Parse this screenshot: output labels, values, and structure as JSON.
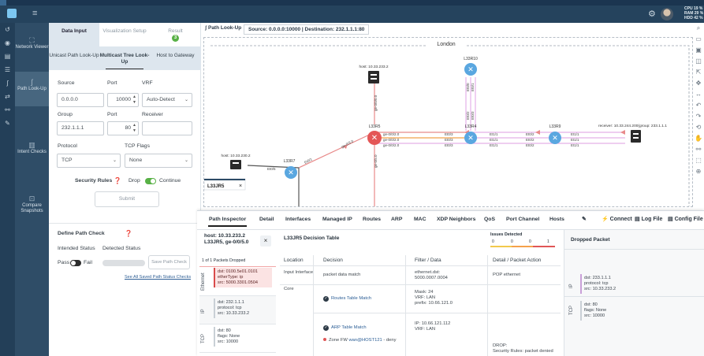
{
  "topbar": {
    "stats_cpu": "CPU 19 %",
    "stats_ram": "RAM 29 %",
    "stats_hdd": "HDD 42 %"
  },
  "nav": {
    "items": [
      {
        "label": "Network Viewer",
        "icon": "network-icon"
      },
      {
        "label": "Path Look-Up",
        "icon": "path-icon"
      },
      {
        "label": "Intent Checks",
        "icon": "intent-icon"
      },
      {
        "label": "Compare Snapshots",
        "icon": "compare-icon"
      }
    ]
  },
  "config": {
    "tabs": {
      "data_input": "Data Input",
      "vis_setup": "Visualization Setup",
      "result": "Result",
      "result_badge": "3"
    },
    "subtabs": {
      "unicast": "Unicast Path Look-Up",
      "multicast": "Multicast Tree Look-Up",
      "host": "Host to Gateway"
    },
    "labels": {
      "source": "Source",
      "port": "Port",
      "vrf": "VRF",
      "group": "Group",
      "port2": "Port",
      "receiver": "Receiver",
      "protocol": "Protocol",
      "tcp_flags": "TCP Flags"
    },
    "values": {
      "source": "0.0.0.0",
      "port": "10000",
      "vrf": "Auto-Detect",
      "group": "232.1.1.1",
      "group_port": "80",
      "receiver": "",
      "protocol": "TCP",
      "tcp_flags": "None"
    },
    "security_rules": {
      "label": "Security Rules",
      "drop": "Drop",
      "continue": "Continue"
    },
    "submit": "Submit",
    "path_check": {
      "title": "Define Path Check",
      "intended": "Intended Status",
      "detected": "Detected Status",
      "pass": "Pass",
      "fail": "Fail",
      "save": "Save Path Check",
      "see_all": "See All Saved Path Status Checks"
    }
  },
  "topo": {
    "button": "Path Look-Up",
    "crumb": "Source: 0.0.0.0:10000 | Destination: 232.1.1.1:80",
    "region": "London",
    "host_top": "host: 10.33.233.2",
    "host_left": "host: 10.33.230.2",
    "receiver": "receiver: 10.33.244.200(group: 233.1.1.1",
    "nodes": {
      "r10": "L33R10",
      "r5": "L33R5",
      "r4": "L33R4",
      "r9": "L33R9",
      "r7": "L33R7",
      "jr5": "L33JR5"
    },
    "ifaces": {
      "ge000": "ge-0/0/0.0",
      "ge020a": "ge-0/0/2.0",
      "ge020b": "ge-0/0/2.0",
      "ge020c": "ge-0/0/2.0",
      "et03a": "Et0/3",
      "et03b": "Et0/3",
      "et03c": "Et0/3",
      "et11a": "Et1/1",
      "et11b": "Et1/1",
      "et11c": "Et1/1",
      "et02a": "Et0/2",
      "et02b": "Et0/2",
      "et02c": "Et0/2",
      "r9a": "Et1/1",
      "r9b": "Et1/1",
      "r9c": "Et1/1",
      "et00": "Et0/0",
      "et01": "Et0/1",
      "et02v": "Et0/2",
      "et03v": "Et0/3",
      "ge050": "ge-0/5.0",
      "ge030": "ge-0/3.0",
      "et05": "Et0/5",
      "et01b": "Et0/1"
    }
  },
  "inspector": {
    "tabs": [
      "Path Inspector",
      "Detail",
      "Interfaces",
      "Managed IP",
      "Routes",
      "ARP",
      "MAC",
      "XDP Neighbors",
      "QoS",
      "Port Channel",
      "Hosts"
    ],
    "tools": {
      "connect": "Connect",
      "log": "Log File",
      "config": "Config File"
    },
    "hop": {
      "line1": "host: 10.33.233.2",
      "line2": "L33JR5, ge-0/0/5.0"
    },
    "packets_dropped": "1 of 1 Packets Dropped",
    "pkt_eth": {
      "label": "Ethernet",
      "dst": "dst: 0100.5e01.0101",
      "type": "etherType: ip",
      "src": "src: 5000.3301.0504"
    },
    "pkt_ip": {
      "label": "IP",
      "dst": "dst: 232.1.1.1",
      "proto": "protocol: tcp",
      "src": "src: 10.33.233.2"
    },
    "pkt_tcp": {
      "label": "TCP",
      "dst": "dst: 80",
      "flags": "flags: None",
      "src": "src: 10000"
    },
    "table_title": "L33JR5 Decision Table",
    "issues": {
      "title": "Issues Detected",
      "n0": "0",
      "n1": "0",
      "n2": "0",
      "n3": "1"
    },
    "cols": {
      "location": "Location",
      "decision": "Decision",
      "filter": "Filter / Data",
      "action": "Detail / Packet Action"
    },
    "rows": {
      "r1_loc": "Input Interface",
      "r1_dec": "packet data match",
      "r1_filter1": "ethernet.dst:",
      "r1_filter2": "5000.0007.0004",
      "r1_action": "POP ethernet",
      "r2_loc": "Core",
      "r2_dec": "Routes Table Match",
      "r2_filter1": "Mask: 24",
      "r2_filter2": "VRF: LAN",
      "r2_filter3": "prefix: 10.66.121.0",
      "r3_dec": "ARP Table Match",
      "r3_filter1": "IP: 10.66.121.112",
      "r3_filter2": "VRF: LAN",
      "r4_dec_pre": "Zone FW",
      "r4_dec_link": "wan@HOST121",
      "r4_dec_post": "- deny",
      "r4_action1": "DROP:",
      "r4_action2": "Security Rules: packet denied"
    },
    "dropped": {
      "title": "Dropped Packet",
      "ip_label": "IP",
      "ip_dst": "dst: 233.1.1.1",
      "ip_proto": "protocol: tcp",
      "ip_src": "src: 10.33.233.2",
      "tcp_label": "TCP",
      "tcp_dst": "dst: 80",
      "tcp_flags": "flags: None",
      "tcp_src": "src: 10000"
    }
  }
}
